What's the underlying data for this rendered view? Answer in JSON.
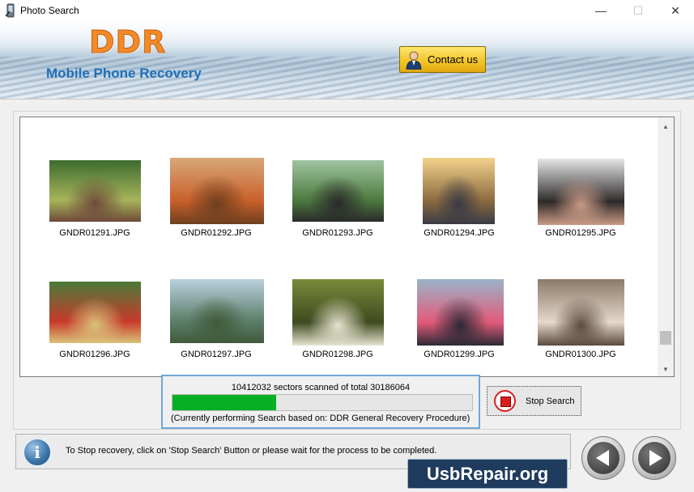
{
  "window": {
    "title": "Photo Search",
    "controls": {
      "minimize": "—",
      "maximize": "☐",
      "close": "✕"
    }
  },
  "header": {
    "brand": "DDR",
    "subtitle": "Mobile Phone Recovery",
    "contact_label": "Contact us",
    "colors": {
      "brand": "#f28a2a",
      "subtitle": "#1e6fb8"
    }
  },
  "results": {
    "items": [
      {
        "filename": "GNDR01291.JPG",
        "palette": [
          "#3d6b2e",
          "#a7b45a",
          "#6e4a3a"
        ]
      },
      {
        "filename": "GNDR01292.JPG",
        "palette": [
          "#d9a77a",
          "#c8602a",
          "#6e3f1f"
        ]
      },
      {
        "filename": "GNDR01293.JPG",
        "palette": [
          "#9fc3a0",
          "#4d7a3f",
          "#2a2a2a"
        ]
      },
      {
        "filename": "GNDR01294.JPG",
        "palette": [
          "#f3d38a",
          "#8a6a40",
          "#3a3a45"
        ]
      },
      {
        "filename": "GNDR01295.JPG",
        "palette": [
          "#e6e6e6",
          "#2e2a2a",
          "#c99a85"
        ]
      },
      {
        "filename": "GNDR01296.JPG",
        "palette": [
          "#4a7a3a",
          "#c83a2a",
          "#d9c27a"
        ]
      },
      {
        "filename": "GNDR01297.JPG",
        "palette": [
          "#b9d0dd",
          "#5d7f6a",
          "#3f5a3a"
        ]
      },
      {
        "filename": "GNDR01298.JPG",
        "palette": [
          "#7a8a3a",
          "#3f4a1f",
          "#e6e3d0"
        ]
      },
      {
        "filename": "GNDR01299.JPG",
        "palette": [
          "#9ab3c9",
          "#e35a7a",
          "#2a2a35"
        ]
      },
      {
        "filename": "GNDR01300.JPG",
        "palette": [
          "#8a7a6a",
          "#e6d9c9",
          "#5a4a3f"
        ]
      }
    ]
  },
  "progress": {
    "status_text": "10412032 sectors scanned of total 30186064",
    "fraction": 0.345,
    "note": "(Currently performing Search based on:  DDR General Recovery Procedure)",
    "fill_color": "#06b025"
  },
  "stop_button": {
    "label": "Stop Search"
  },
  "info": {
    "icon_glyph": "i",
    "message": "To Stop recovery, click on 'Stop Search' Button or please wait for the process to be completed."
  },
  "watermark": {
    "text": "UsbRepair.org"
  },
  "icons": {
    "app": "phone-icon",
    "contact": "person-icon",
    "stop": "stop-icon",
    "info": "info-icon",
    "back": "arrow-left-icon",
    "next": "arrow-right-icon"
  }
}
